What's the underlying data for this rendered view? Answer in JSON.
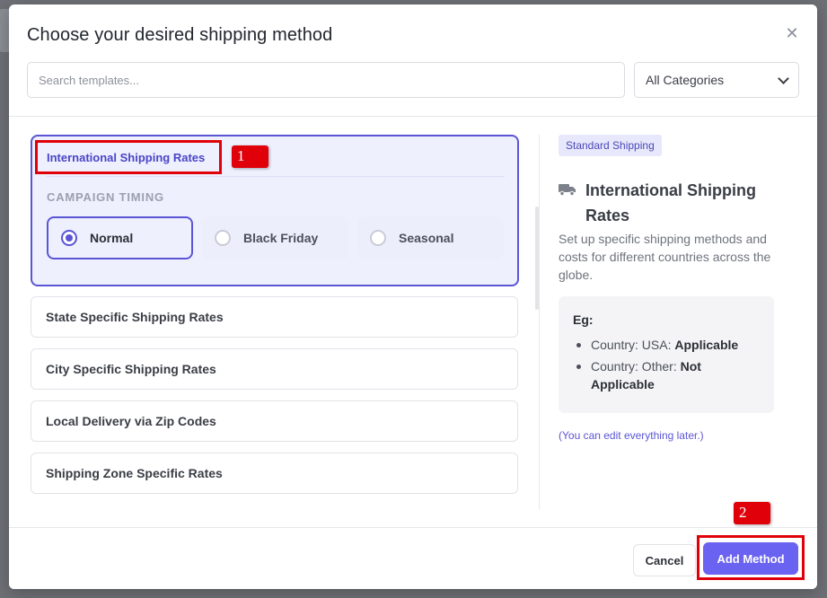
{
  "modal": {
    "title": "Choose your desired shipping method",
    "close_icon": "close-icon",
    "search": {
      "placeholder": "Search templates...",
      "value": ""
    },
    "category_select": {
      "selected": "All Categories"
    }
  },
  "templates": {
    "active": {
      "title": "International Shipping Rates",
      "timing_label": "CAMPAIGN TIMING",
      "options": [
        {
          "label": "Normal",
          "selected": true
        },
        {
          "label": "Black Friday",
          "selected": false
        },
        {
          "label": "Seasonal",
          "selected": false
        }
      ]
    },
    "items": [
      "State Specific Shipping Rates",
      "City Specific Shipping Rates",
      "Local Delivery via Zip Codes",
      "Shipping Zone Specific Rates"
    ]
  },
  "detail": {
    "badge": "Standard Shipping",
    "icon": "truck-icon",
    "title": "International Shipping Rates",
    "description": "Set up specific shipping methods and costs for different countries across the globe.",
    "example_label": "Eg:",
    "examples": [
      {
        "text": "Country: USA: ",
        "value": "Applicable"
      },
      {
        "text": "Country: Other: ",
        "value": "Not Applicable"
      }
    ],
    "note": "(You can edit everything later.)"
  },
  "footer": {
    "cancel_label": "Cancel",
    "add_label": "Add Method"
  },
  "annotations": [
    "1",
    "2"
  ],
  "colors": {
    "accent": "#5b55d6",
    "primary_button": "#6a62f0",
    "annotation": "#e0000a"
  }
}
